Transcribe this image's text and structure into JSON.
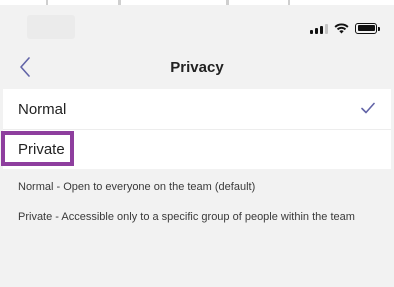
{
  "nav": {
    "title": "Privacy",
    "back_icon": "chevron-left-icon"
  },
  "status_bar": {
    "icons": [
      "signal-icon",
      "wifi-icon",
      "battery-icon"
    ]
  },
  "options": [
    {
      "label": "Normal",
      "selected": true
    },
    {
      "label": "Private",
      "selected": false,
      "highlighted": true
    }
  ],
  "descriptions": {
    "normal": "Normal - Open to everyone on the team (default)",
    "private": "Private - Accessible only to a specific group of people within the team"
  },
  "colors": {
    "accent": "#6264a7",
    "highlight": "#8e3e9e",
    "background": "#f2f2f2",
    "row_background": "#ffffff"
  }
}
